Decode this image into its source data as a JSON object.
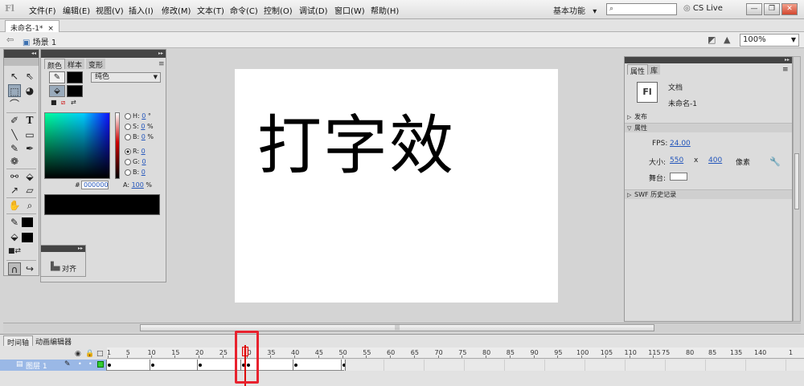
{
  "app": {
    "logo": "Fl"
  },
  "menu": [
    "文件(F)",
    "编辑(E)",
    "视图(V)",
    "插入(I)",
    "修改(M)",
    "文本(T)",
    "命令(C)",
    "控制(O)",
    "调试(D)",
    "窗口(W)",
    "帮助(H)"
  ],
  "workspace": {
    "label": "基本功能",
    "arrow": "▾"
  },
  "search": {
    "placeholder": ""
  },
  "cslive": {
    "label": "CS Live"
  },
  "window_buttons": {
    "minimize": "—",
    "restore": "❐",
    "close": "✕"
  },
  "doc_tab": {
    "label": "未命名-1*",
    "close": "×"
  },
  "editbar": {
    "scene": "场景 1",
    "zoom": "100%"
  },
  "stage": {
    "text": "打字效"
  },
  "color_panel": {
    "tabs": [
      "颜色",
      "样本",
      "变形"
    ],
    "type": "纯色",
    "h": {
      "label": "H:",
      "value": "0",
      "unit": "°"
    },
    "s": {
      "label": "S:",
      "value": "0",
      "unit": "%"
    },
    "b": {
      "label": "B:",
      "value": "0",
      "unit": "%"
    },
    "r": {
      "label": "R:",
      "value": "0"
    },
    "g": {
      "label": "G:",
      "value": "0"
    },
    "bl": {
      "label": "B:",
      "value": "0"
    },
    "hex_label": "#",
    "hex": "000000",
    "alpha_label": "A:",
    "alpha": "100",
    "alpha_unit": "%"
  },
  "align_panel": {
    "label": "对齐"
  },
  "properties": {
    "tabs": [
      "属性",
      "库"
    ],
    "doc_icon": "Fl",
    "doc_type": "文档",
    "doc_name": "未命名-1",
    "sections": {
      "publish": "发布",
      "properties": "属性",
      "swf": "SWF 历史记录"
    },
    "fps_label": "FPS:",
    "fps": "24.00",
    "size_label": "大小:",
    "width": "550",
    "x": "x",
    "height": "400",
    "unit": "像素",
    "stage_label": "舞台:"
  },
  "timeline": {
    "tabs": [
      "时间轴",
      "动画编辑器"
    ],
    "layer": "图层 1",
    "ticks": [
      {
        "label": "1",
        "frame": 1
      },
      {
        "label": "5",
        "frame": 5
      },
      {
        "label": "10",
        "frame": 10
      },
      {
        "label": "15",
        "frame": 15
      },
      {
        "label": "20",
        "frame": 20
      },
      {
        "label": "25",
        "frame": 25
      },
      {
        "label": "30",
        "frame": 30
      },
      {
        "label": "35",
        "frame": 35
      },
      {
        "label": "40",
        "frame": 40
      },
      {
        "label": "45",
        "frame": 45
      },
      {
        "label": "50",
        "frame": 50
      },
      {
        "label": "55",
        "frame": 55
      },
      {
        "label": "60",
        "frame": 60
      },
      {
        "label": "65",
        "frame": 65
      },
      {
        "label": "70",
        "frame": 70
      },
      {
        "label": "75",
        "frame": 75
      },
      {
        "label": "80",
        "frame": 80
      },
      {
        "label": "85",
        "frame": 85
      },
      {
        "label": "90",
        "frame": 90
      },
      {
        "label": "95",
        "frame": 95
      },
      {
        "label": "100",
        "frame": 100
      },
      {
        "label": "105",
        "frame": 105
      },
      {
        "label": "110",
        "frame": 110
      },
      {
        "label": "115",
        "frame": 115
      }
    ],
    "right_ticks": [
      "75",
      "80",
      "85",
      "135",
      "140",
      "1"
    ],
    "current_frame": 30,
    "keyframes": [
      1,
      10,
      20,
      29,
      30,
      40,
      50
    ]
  }
}
